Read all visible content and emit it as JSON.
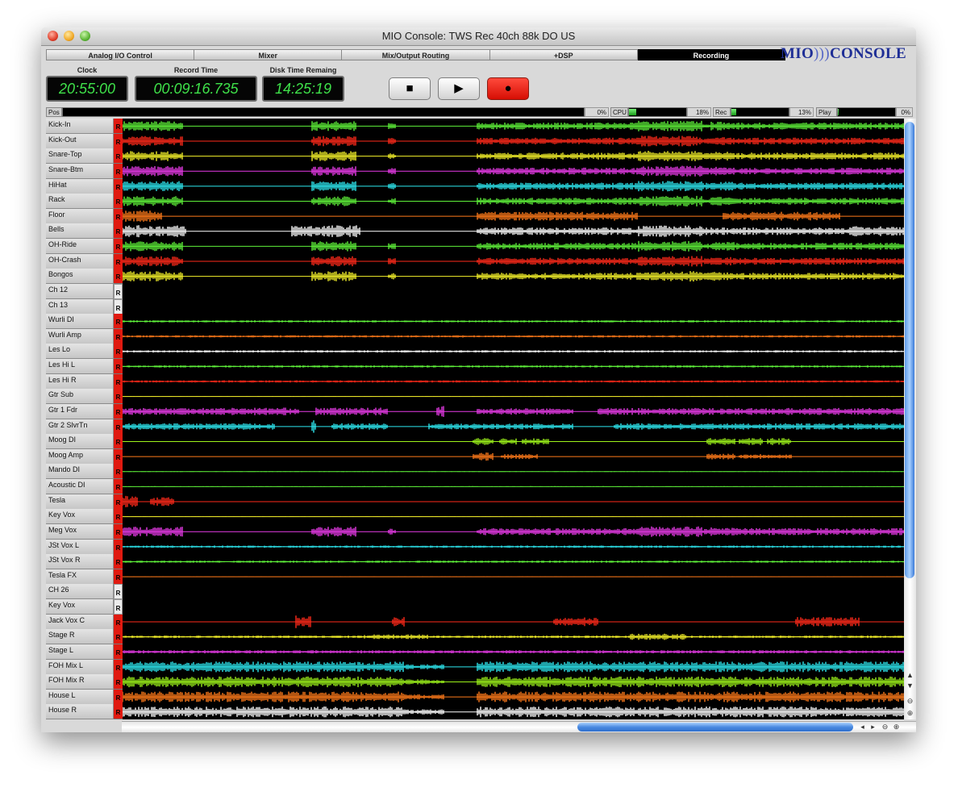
{
  "window": {
    "title": "MIO Console: TWS Rec 40ch 88k DO US"
  },
  "tabs": [
    {
      "label": "Analog I/O Control",
      "active": false
    },
    {
      "label": "Mixer",
      "active": false
    },
    {
      "label": "Mix/Output Routing",
      "active": false
    },
    {
      "label": "+DSP",
      "active": false
    },
    {
      "label": "Recording",
      "active": true
    }
  ],
  "logo": {
    "left": "MIO",
    "arc": ")))",
    "right": "CONSOLE"
  },
  "displays": {
    "clock": {
      "label": "Clock",
      "value": "20:55:00"
    },
    "record_time": {
      "label": "Record Time",
      "value": "00:09:16.735"
    },
    "disk_time": {
      "label": "Disk Time Remaing",
      "value": "14:25:19"
    }
  },
  "transport": {
    "stop_icon": "stop-icon",
    "play_icon": "play-icon",
    "record_icon": "record-icon",
    "stop_glyph": "■",
    "play_glyph": "▶",
    "record_glyph": "●"
  },
  "meters": {
    "pos": {
      "label": "Pos",
      "value": "0%",
      "fraction": 0.0
    },
    "cpu": {
      "label": "CPU",
      "value": "18%",
      "fraction": 0.12
    },
    "rec": {
      "label": "Rec",
      "value": "13%",
      "fraction": 0.08
    },
    "play": {
      "label": "Play",
      "value": "0%",
      "fraction": 0.01
    }
  },
  "colors": {
    "green": "#5ff23a",
    "red": "#ff2a1a",
    "yellow": "#f5f22a",
    "magenta": "#e83be8",
    "cyan": "#2ee8f0",
    "orange": "#ff7a1a",
    "white": "#ffffff",
    "lime": "#9cf21a",
    "record_armed": "#e01a10",
    "lcd_text": "#3fe24a"
  },
  "tracks": [
    {
      "name": "Kick-In",
      "armed": true,
      "color": "green",
      "activity": "drums"
    },
    {
      "name": "Kick-Out",
      "armed": true,
      "color": "red",
      "activity": "drums"
    },
    {
      "name": "Snare-Top",
      "armed": true,
      "color": "yellow",
      "activity": "drums"
    },
    {
      "name": "Snare-Btm",
      "armed": true,
      "color": "magenta",
      "activity": "drums"
    },
    {
      "name": "HiHat",
      "armed": true,
      "color": "cyan",
      "activity": "drums"
    },
    {
      "name": "Rack",
      "armed": true,
      "color": "green",
      "activity": "drums"
    },
    {
      "name": "Floor",
      "armed": true,
      "color": "orange",
      "activity": "floor"
    },
    {
      "name": "Bells",
      "armed": true,
      "color": "white",
      "activity": "drums_loud"
    },
    {
      "name": "OH-Ride",
      "armed": true,
      "color": "green",
      "activity": "drums"
    },
    {
      "name": "OH-Crash",
      "armed": true,
      "color": "red",
      "activity": "drums"
    },
    {
      "name": "Bongos",
      "armed": true,
      "color": "yellow",
      "activity": "drums"
    },
    {
      "name": "Ch 12",
      "armed": false,
      "color": "none",
      "activity": "none"
    },
    {
      "name": "Ch 13",
      "armed": false,
      "color": "none",
      "activity": "none"
    },
    {
      "name": "Wurli DI",
      "armed": true,
      "color": "green",
      "activity": "quiet"
    },
    {
      "name": "Wurli Amp",
      "armed": true,
      "color": "orange",
      "activity": "quiet"
    },
    {
      "name": "Les Lo",
      "armed": true,
      "color": "white",
      "activity": "quiet"
    },
    {
      "name": "Les Hi L",
      "armed": true,
      "color": "green",
      "activity": "quiet"
    },
    {
      "name": "Les Hi R",
      "armed": true,
      "color": "red",
      "activity": "quiet"
    },
    {
      "name": "Gtr Sub",
      "armed": true,
      "color": "yellow",
      "activity": "flat"
    },
    {
      "name": "Gtr 1 Fdr",
      "armed": true,
      "color": "magenta",
      "activity": "guitar"
    },
    {
      "name": "Gtr 2 SlvrTn",
      "armed": true,
      "color": "cyan",
      "activity": "guitar2"
    },
    {
      "name": "Moog DI",
      "armed": true,
      "color": "lime",
      "activity": "moog"
    },
    {
      "name": "Moog Amp",
      "armed": true,
      "color": "orange",
      "activity": "moog2"
    },
    {
      "name": "Mando DI",
      "armed": true,
      "color": "green",
      "activity": "flat"
    },
    {
      "name": "Acoustic DI",
      "armed": true,
      "color": "green",
      "activity": "flat"
    },
    {
      "name": "Tesla",
      "armed": true,
      "color": "red",
      "activity": "tesla"
    },
    {
      "name": "Key Vox",
      "armed": true,
      "color": "yellow",
      "activity": "flat"
    },
    {
      "name": "Meg Vox",
      "armed": true,
      "color": "magenta",
      "activity": "drums"
    },
    {
      "name": "JSt Vox L",
      "armed": true,
      "color": "cyan",
      "activity": "quiet"
    },
    {
      "name": "JSt Vox R",
      "armed": true,
      "color": "green",
      "activity": "quiet"
    },
    {
      "name": "Tesla FX",
      "armed": true,
      "color": "orange",
      "activity": "flat"
    },
    {
      "name": "CH 26",
      "armed": false,
      "color": "none",
      "activity": "none"
    },
    {
      "name": "Key Vox",
      "armed": false,
      "color": "none",
      "activity": "none"
    },
    {
      "name": "Jack Vox C",
      "armed": true,
      "color": "red",
      "activity": "vox"
    },
    {
      "name": "Stage R",
      "armed": true,
      "color": "yellow",
      "activity": "stage"
    },
    {
      "name": "Stage L",
      "armed": true,
      "color": "magenta",
      "activity": "stage2"
    },
    {
      "name": "FOH Mix L",
      "armed": true,
      "color": "cyan",
      "activity": "mix"
    },
    {
      "name": "FOH Mix R",
      "armed": true,
      "color": "lime",
      "activity": "mix"
    },
    {
      "name": "House L",
      "armed": true,
      "color": "orange",
      "activity": "mix"
    },
    {
      "name": "House R",
      "armed": true,
      "color": "white",
      "activity": "mix"
    }
  ],
  "record_button_label": "R",
  "scroll": {
    "up_icon": "▲",
    "down_icon": "▼",
    "left_icon": "◂",
    "right_icon": "▸",
    "zoom_out_icon": "⊖",
    "zoom_in_icon": "⊕"
  }
}
